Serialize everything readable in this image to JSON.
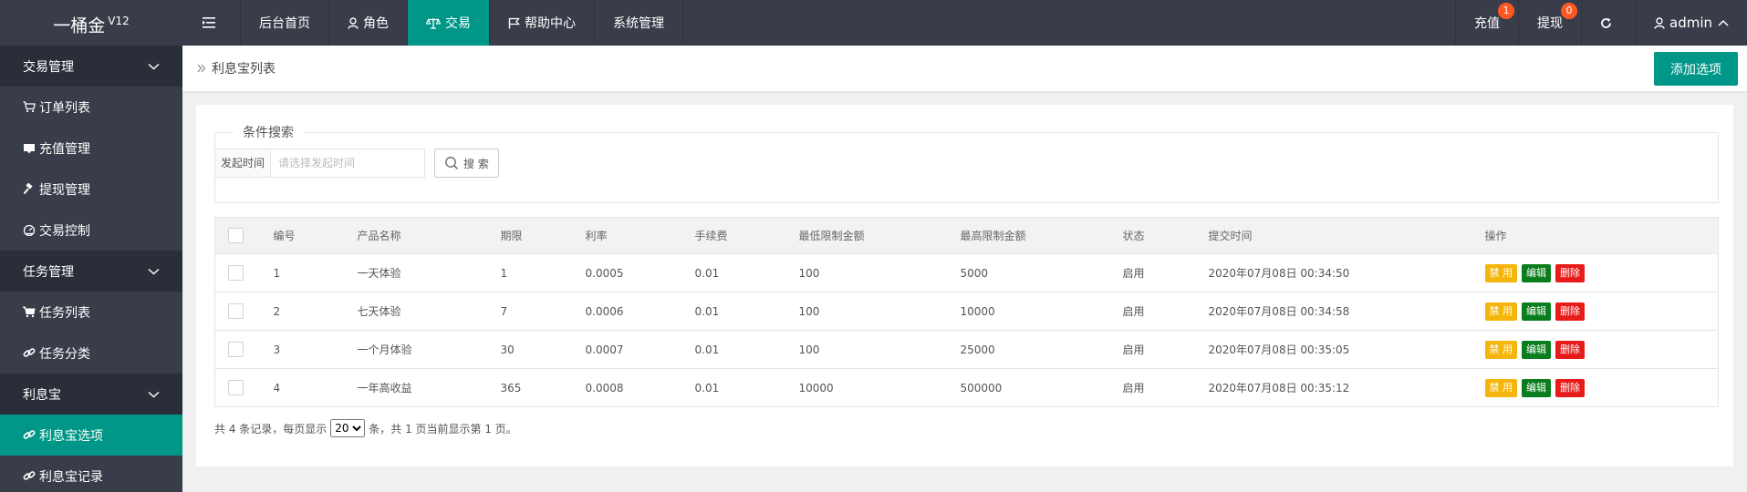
{
  "logo": {
    "name": "一桶金",
    "version": "V12"
  },
  "topnav": {
    "items": [
      {
        "label": "后台首页",
        "icon": ""
      },
      {
        "label": "角色",
        "icon": "user-icon"
      },
      {
        "label": "交易",
        "icon": "scale-icon",
        "active": true
      },
      {
        "label": "帮助中心",
        "icon": "flag-icon"
      },
      {
        "label": "系统管理",
        "icon": ""
      }
    ]
  },
  "topright": {
    "recharge": {
      "label": "充值",
      "badge": "1"
    },
    "withdraw": {
      "label": "提现",
      "badge": "0"
    },
    "user": {
      "name": "admin"
    }
  },
  "sidebar": {
    "groups": [
      {
        "label": "交易管理",
        "items": [
          "订单列表",
          "充值管理",
          "提现管理",
          "交易控制"
        ]
      },
      {
        "label": "任务管理",
        "items": [
          "任务列表",
          "任务分类"
        ]
      },
      {
        "label": "利息宝",
        "items": [
          "利息宝选项",
          "利息宝记录"
        ]
      }
    ]
  },
  "breadcrumb": {
    "current": "利息宝列表"
  },
  "add_button": "添加选项",
  "search": {
    "legend": "条件搜索",
    "field_label": "发起时间",
    "placeholder": "请选择发起时间",
    "button": "搜 索"
  },
  "table": {
    "headers": [
      "编号",
      "产品名称",
      "期限",
      "利率",
      "手续费",
      "最低限制金额",
      "最高限制金额",
      "状态",
      "提交时间",
      "操作"
    ],
    "rows": [
      {
        "id": "1",
        "name": "一天体验",
        "term": "1",
        "rate": "0.0005",
        "fee": "0.01",
        "min": "100",
        "max": "5000",
        "status": "启用",
        "time": "2020年07月08日 00:34:50"
      },
      {
        "id": "2",
        "name": "七天体验",
        "term": "7",
        "rate": "0.0006",
        "fee": "0.01",
        "min": "100",
        "max": "10000",
        "status": "启用",
        "time": "2020年07月08日 00:34:58"
      },
      {
        "id": "3",
        "name": "一个月体验",
        "term": "30",
        "rate": "0.0007",
        "fee": "0.01",
        "min": "100",
        "max": "25000",
        "status": "启用",
        "time": "2020年07月08日 00:35:05"
      },
      {
        "id": "4",
        "name": "一年高收益",
        "term": "365",
        "rate": "0.0008",
        "fee": "0.01",
        "min": "10000",
        "max": "500000",
        "status": "启用",
        "time": "2020年07月08日 00:35:12"
      }
    ],
    "actions": {
      "disable": "禁 用",
      "edit": "编辑",
      "delete": "删除"
    }
  },
  "pager": {
    "prefix": "共 4 条记录，每页显示",
    "page_size": "20",
    "suffix": "条，共 1 页当前显示第 1 页。"
  },
  "colors": {
    "topbar": "#393d49",
    "accent": "#009688",
    "badge": "#ff5722",
    "disable": "#f5b50a",
    "edit": "#0a7d1c",
    "delete": "#e81b1b"
  }
}
